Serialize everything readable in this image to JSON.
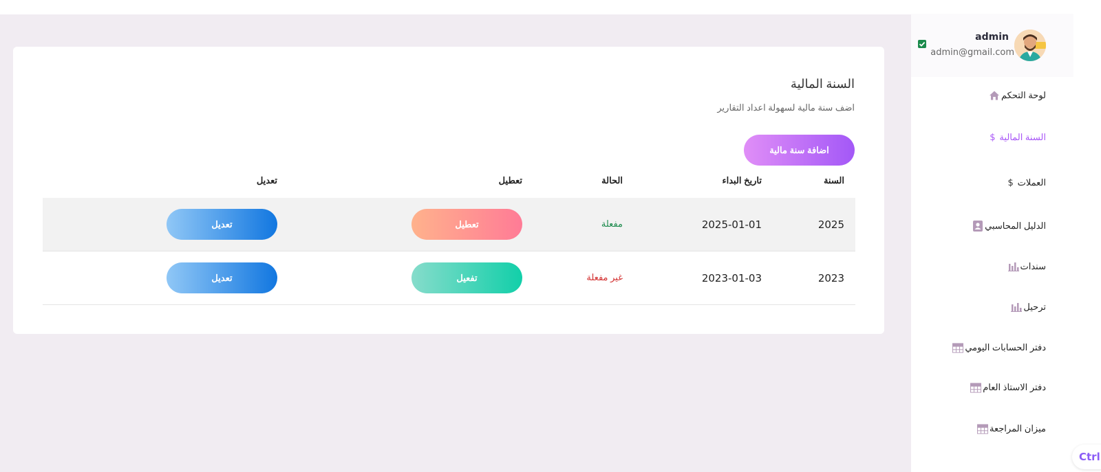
{
  "profile": {
    "name": "admin",
    "email": "admin@gmail.com"
  },
  "sidebar": {
    "items": [
      {
        "label": "لوحة التحكم",
        "icon": "home-icon"
      },
      {
        "label": "السنة المالية",
        "icon": "dollar-icon",
        "active": true
      },
      {
        "label": "العملات",
        "icon": "dollar-icon"
      },
      {
        "label": "الدليل المحاسبي",
        "icon": "contact-book-icon"
      },
      {
        "label": "سندات",
        "icon": "bar-chart-icon"
      },
      {
        "label": "ترحيل",
        "icon": "bar-chart-icon"
      },
      {
        "label": "دفتر الحسابات اليومي",
        "icon": "grid-table-icon"
      },
      {
        "label": "دفتر الاستاذ العام",
        "icon": "grid-table-icon"
      },
      {
        "label": "ميزان المراجعة",
        "icon": "grid-table-icon"
      }
    ]
  },
  "shortcut_badge": "Ctrl+",
  "main": {
    "title": "السنة المالية",
    "subtitle": "اضف سنة مالية لسهولة اعداد التقارير",
    "add_button": "اضافة سنة مالية",
    "table": {
      "headers": {
        "year": "السنة",
        "start_date": "تاريخ البداء",
        "status": "الحالة",
        "toggle": "تعطيل",
        "edit": "تعديل"
      },
      "rows": [
        {
          "year": "2025",
          "start_date": "2025-01-01",
          "status": "مفعلة",
          "toggle_label": "تعطيل",
          "edit_label": "تعديل"
        },
        {
          "year": "2023",
          "start_date": "2023-01-03",
          "status": "غير مفعلة",
          "toggle_label": "تفعيل",
          "edit_label": "تعديل"
        }
      ]
    }
  },
  "colors": {
    "accent": "#a855f7",
    "status_active": "#1b8a4c",
    "status_inactive": "#d32f2f",
    "edit_gradient": [
      "#90c7f6",
      "#1277e0"
    ],
    "disable_gradient": [
      "#ffb28c",
      "#ff7b96"
    ],
    "enable_gradient": [
      "#86dccb",
      "#12cfa9"
    ]
  }
}
